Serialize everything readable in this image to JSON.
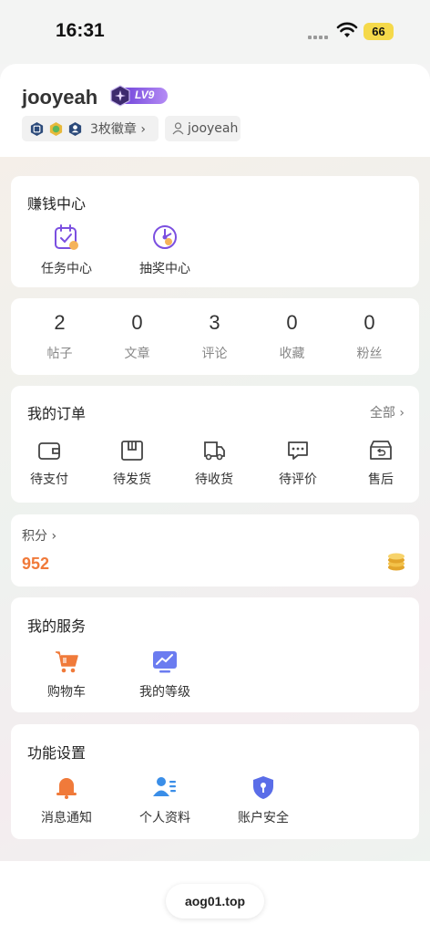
{
  "status_bar": {
    "time": "16:31",
    "battery": "66"
  },
  "profile": {
    "username": "jooyeah",
    "level": "LV9",
    "badges_label": "3枚徽章 ›",
    "uid_label": "jooyeah"
  },
  "earn": {
    "title": "赚钱中心",
    "items": [
      {
        "label": "任务中心",
        "icon": "task-calendar-icon"
      },
      {
        "label": "抽奖中心",
        "icon": "lottery-wheel-icon"
      }
    ]
  },
  "stats": [
    {
      "value": "2",
      "label": "帖子"
    },
    {
      "value": "0",
      "label": "文章"
    },
    {
      "value": "3",
      "label": "评论"
    },
    {
      "value": "0",
      "label": "收藏"
    },
    {
      "value": "0",
      "label": "粉丝"
    }
  ],
  "orders": {
    "title": "我的订单",
    "all_label": "全部 ›",
    "items": [
      {
        "label": "待支付",
        "icon": "wallet-icon"
      },
      {
        "label": "待发货",
        "icon": "box-icon"
      },
      {
        "label": "待收货",
        "icon": "truck-icon"
      },
      {
        "label": "待评价",
        "icon": "comment-icon"
      },
      {
        "label": "售后",
        "icon": "return-box-icon"
      }
    ]
  },
  "points": {
    "label": "积分 ›",
    "value": "952",
    "icon": "coins-icon"
  },
  "services": {
    "title": "我的服务",
    "items": [
      {
        "label": "购物车",
        "icon": "cart-icon"
      },
      {
        "label": "我的等级",
        "icon": "level-chart-icon"
      }
    ]
  },
  "settings": {
    "title": "功能设置",
    "items": [
      {
        "label": "消息通知",
        "icon": "bell-icon"
      },
      {
        "label": "个人资料",
        "icon": "profile-card-icon"
      },
      {
        "label": "账户安全",
        "icon": "shield-icon"
      }
    ]
  },
  "footer": {
    "domain": "aog01.top"
  },
  "colors": {
    "accent_orange": "#f07a3a",
    "purple": "#7b4fe0",
    "blue": "#3a8ee8"
  }
}
